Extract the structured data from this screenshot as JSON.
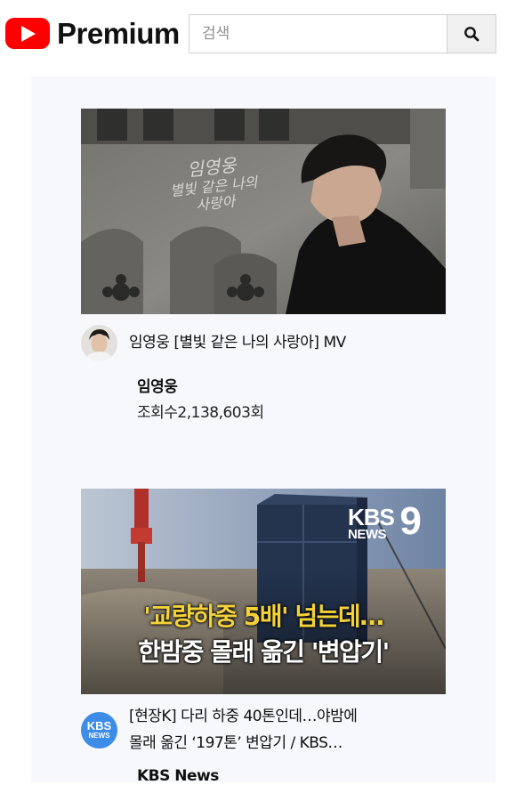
{
  "header": {
    "logo_text": "Premium",
    "logo_icon": "play-button-icon",
    "search_placeholder": "검색",
    "search_icon": "search-icon"
  },
  "colors": {
    "brand": "#ff0000",
    "feed_bg": "#f7f8fc",
    "kbs_blue": "#3d8ce8"
  },
  "videos": [
    {
      "thumbnail_text": [
        "임영웅",
        "별빛 같은 나의",
        "사랑아"
      ],
      "title": "임영웅 [별빛 같은 나의 사랑아] MV",
      "channel": "임영웅",
      "views": "조회수2,138,603회"
    },
    {
      "thumbnail_logo": [
        "KBS",
        "NEWS",
        "9"
      ],
      "thumbnail_caption": [
        "'교량하중 5배' 넘는데…",
        "한밤중 몰래 옮긴 '변압기'"
      ],
      "avatar_text": [
        "KBS",
        "NEWS"
      ],
      "title_lines": [
        "[현장K] 다리 하중 40톤인데…야밤에",
        "몰래 옮긴 ‘197톤’ 변압기 / KBS…"
      ],
      "channel": "KBS News"
    }
  ]
}
